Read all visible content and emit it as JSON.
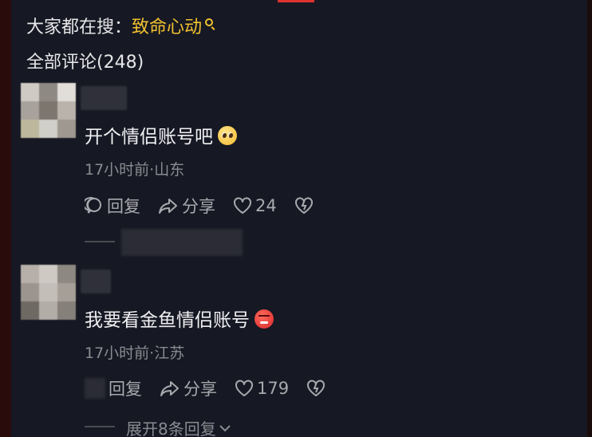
{
  "search_bar": {
    "prefix": "大家都在搜：",
    "term": "致命心动",
    "icon": "search-icon"
  },
  "comments_header": {
    "title": "全部评论(248)"
  },
  "comments": [
    {
      "text": "开个情侣账号吧",
      "emoji": "pleading-face-icon",
      "meta": "17小时前·山东",
      "reply_label": "回复",
      "share_label": "分享",
      "like_count": "24"
    },
    {
      "text": "我要看金鱼情侣账号",
      "emoji": "angry-face-icon",
      "meta": "17小时前·江苏",
      "reply_label": "回复",
      "share_label": "分享",
      "like_count": "179",
      "expand_label": "展开8条回复"
    }
  ],
  "colors": {
    "background": "#161823",
    "accent": "#f2c230",
    "text": "#e6e6e8",
    "muted": "#8a8b91"
  }
}
